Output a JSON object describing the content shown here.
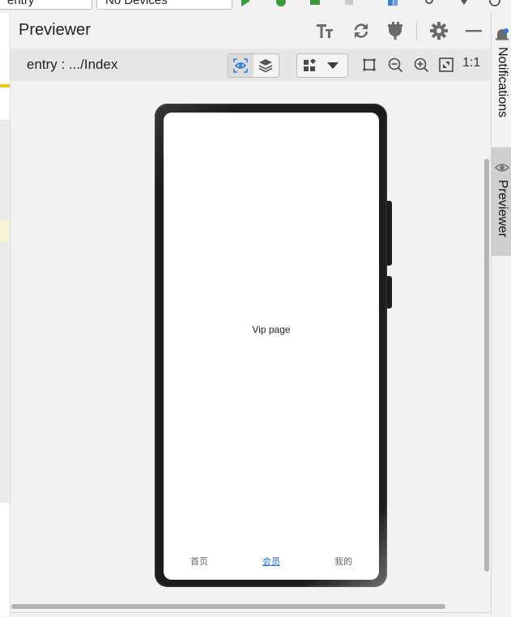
{
  "toolbar": {
    "module_select": "entry",
    "device_select": "No Devices"
  },
  "previewer": {
    "title": "Previewer",
    "path": "entry : .../Index",
    "zoom_actual": "1:1"
  },
  "device_screen": {
    "page_text": "Vip page",
    "tabs": [
      {
        "label": "首页",
        "active": false
      },
      {
        "label": "会员",
        "active": true
      },
      {
        "label": "我的",
        "active": false
      }
    ]
  },
  "right_strip": {
    "notifications_label": "Notifications",
    "previewer_label": "Previewer"
  },
  "colors": {
    "accent": "#1e6fe0",
    "phone_frame": "#1c1c1c",
    "panel_bg": "#f2f2f2"
  }
}
